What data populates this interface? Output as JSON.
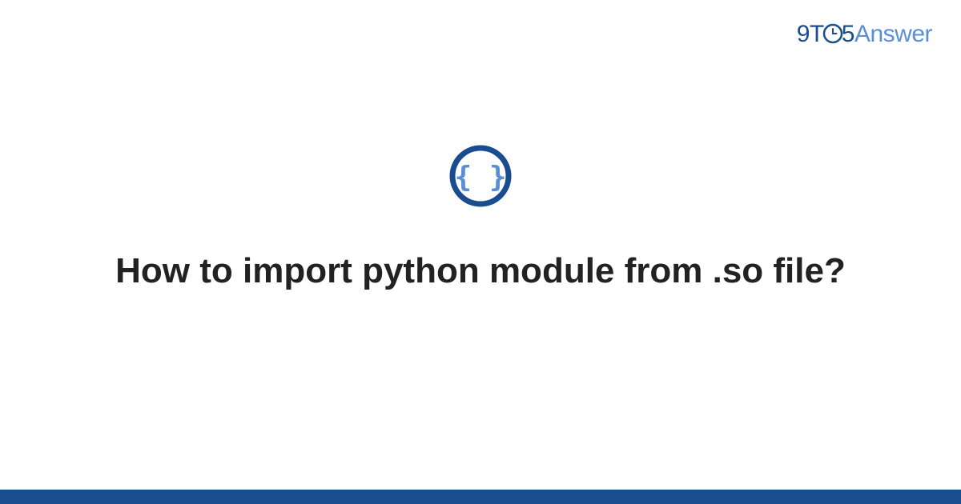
{
  "logo": {
    "part1": "9T",
    "part2": "5",
    "part3": "Answer"
  },
  "icon": {
    "name": "code-braces-icon"
  },
  "title": "How to import python module from .so file?",
  "colors": {
    "primary": "#1a4d8f",
    "secondary": "#5a8fd6",
    "text": "#222222"
  }
}
